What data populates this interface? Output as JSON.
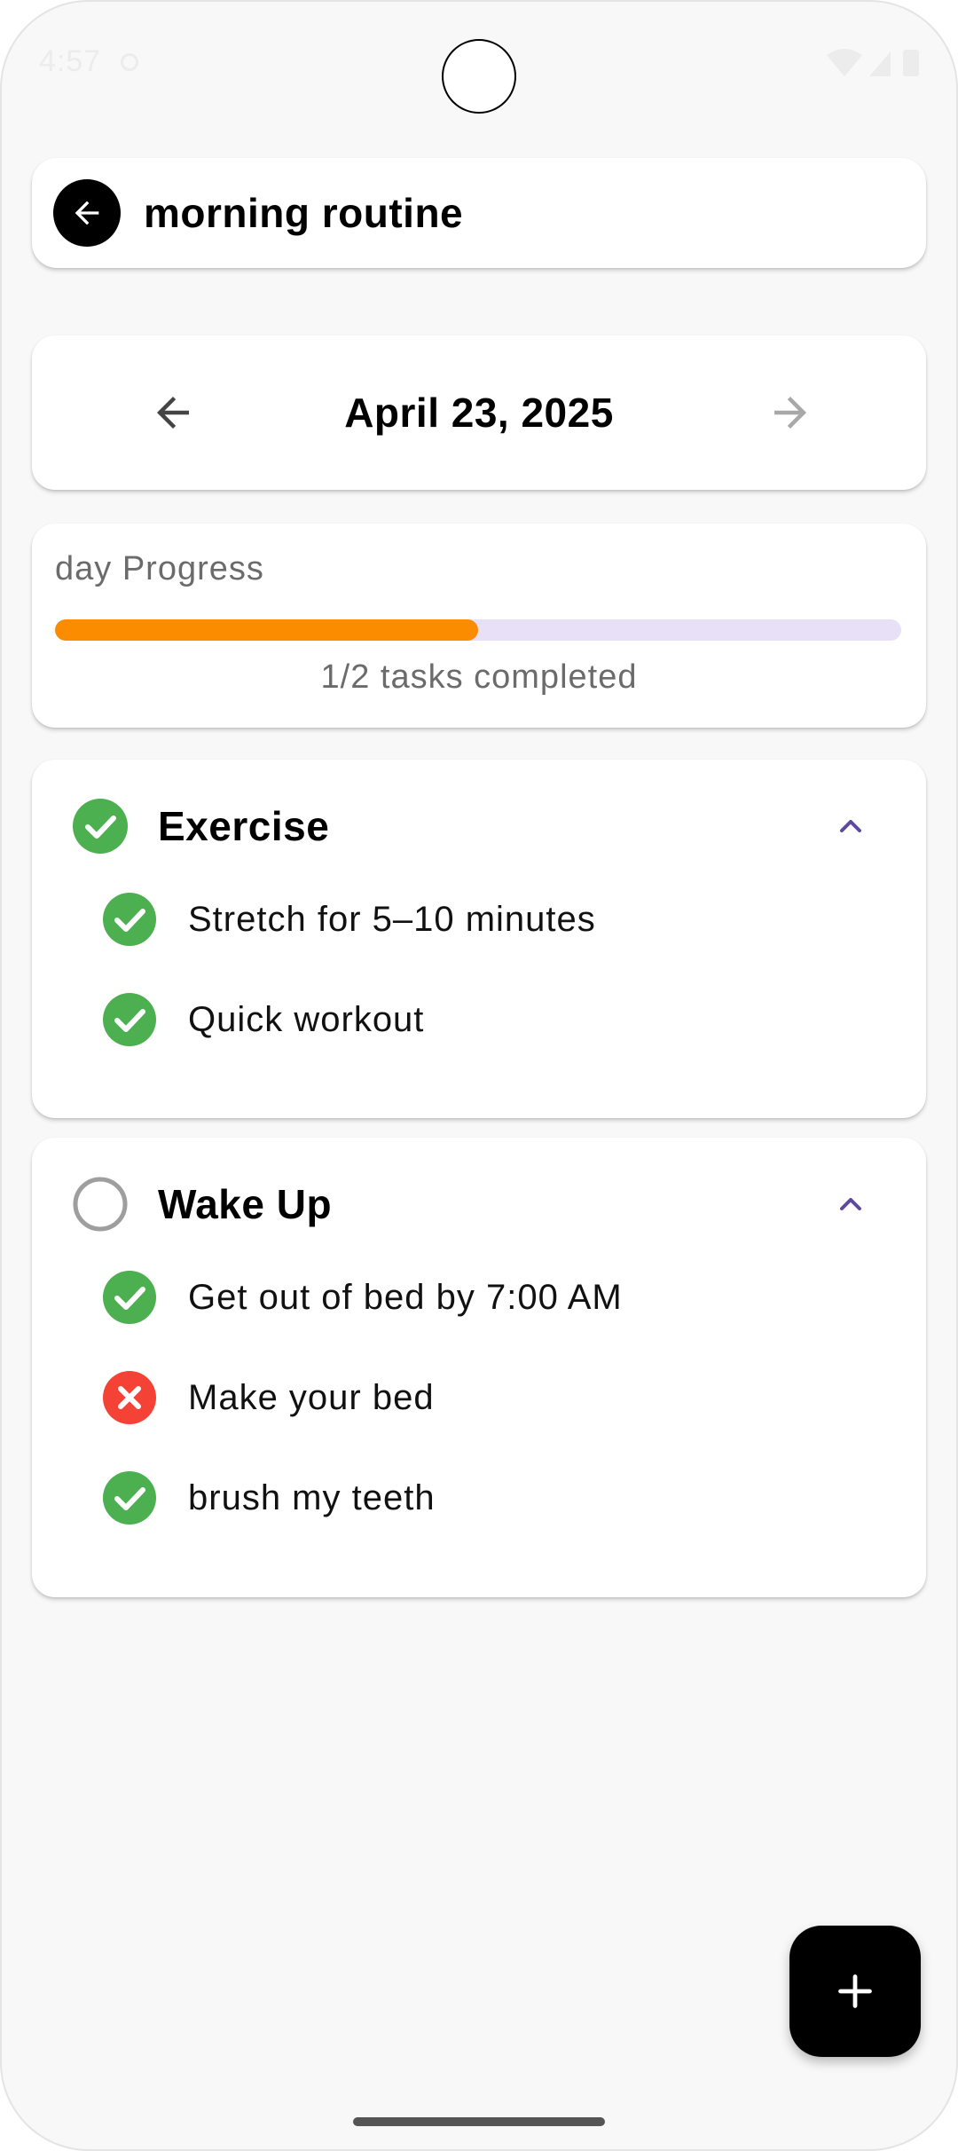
{
  "status_bar": {
    "time": "4:57"
  },
  "header": {
    "title": "morning routine"
  },
  "date_nav": {
    "date": "April 23, 2025"
  },
  "progress": {
    "title": "day Progress",
    "completed": 1,
    "total": 2,
    "fraction": 0.5,
    "text": "1/2 tasks completed",
    "fill_color": "#fb8c00",
    "track_color": "#e8e0f7"
  },
  "groups": [
    {
      "title": "Exercise",
      "status": "done",
      "expanded": true,
      "tasks": [
        {
          "label": "Stretch for 5–10 minutes",
          "status": "done"
        },
        {
          "label": "Quick workout",
          "status": "done"
        }
      ]
    },
    {
      "title": "Wake Up",
      "status": "pending",
      "expanded": true,
      "tasks": [
        {
          "label": "Get out of bed by 7:00 AM",
          "status": "done"
        },
        {
          "label": "Make your bed",
          "status": "failed"
        },
        {
          "label": "brush my teeth",
          "status": "done"
        }
      ]
    }
  ],
  "colors": {
    "done": "#4caf50",
    "failed": "#f44336",
    "pending_ring": "#9e9e9e",
    "accent": "#5e4a9c"
  },
  "icons": {
    "back": "arrow-left-icon",
    "prev_date": "arrow-left-icon",
    "next_date": "arrow-right-icon",
    "collapse": "chevron-up-icon",
    "add": "plus-icon"
  }
}
